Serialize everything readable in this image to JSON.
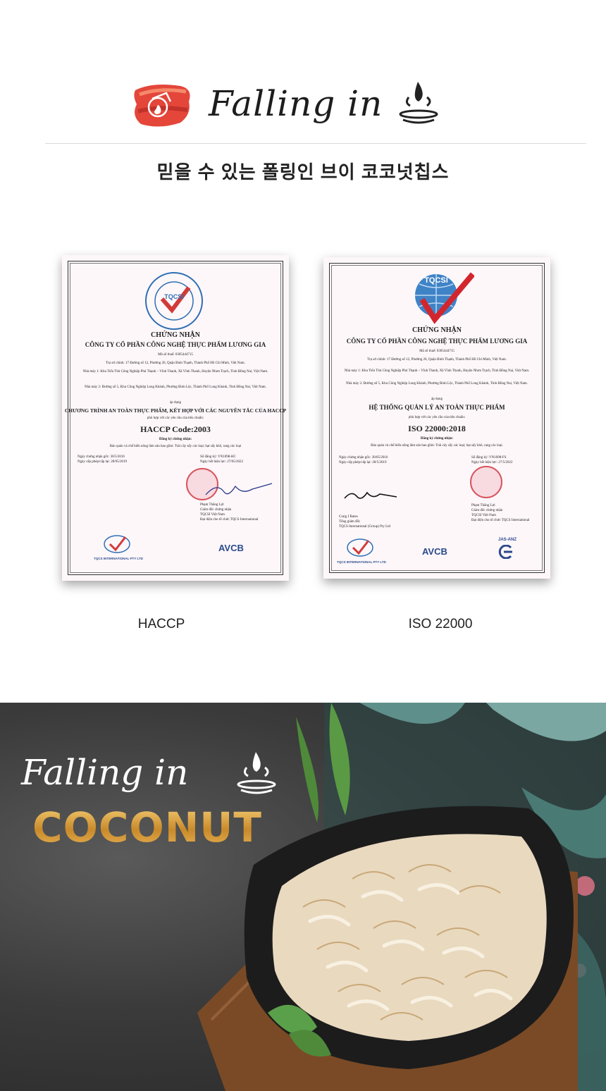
{
  "header": {
    "logo_icon": "brand-emblem-icon",
    "script_title": "Falling in",
    "drop_icon": "water-splash-icon",
    "subtitle": "믿을 수 있는 폴링인 브이 코코넛칩스"
  },
  "certificates": [
    {
      "caption": "HACCP",
      "logo_ring_text": "Food Safety Program",
      "logo_ring_bottom": "HACCP Certified",
      "logo_center": "TQCSI",
      "heading": "CHỨNG NHẬN",
      "company": "CÔNG TY CỔ PHẦN CÔNG NGHỆ THỰC PHẨM LƯƠNG GIA",
      "tax_code": "Mã số thuế: 0305444715",
      "address": "Trụ sở chính: 17 Đường số 12, Phường 26, Quận Bình Thạnh, Thành Phố Hồ Chí Minh, Việt Nam.",
      "factory1": "Nhà máy 1: Khu Tiểu Thủ Công Nghiệp Phú Thạnh – Vĩnh Thanh, Xã Vĩnh Thanh, Huyện Nhơn Trạch, Tỉnh Đồng Nai, Việt Nam.",
      "factory2": "Nhà máy 2: Đường số 5, Khu Công Nghiệp Long Khánh, Phường Bình Lộc, Thành Phố Long Khánh, Tỉnh Đồng Nai, Việt Nam.",
      "applies": "áp dụng",
      "standard": "CHƯƠNG TRÌNH AN TOÀN THỰC PHẨM, KẾT HỢP VỚI CÁC NGUYÊN TẮC CỦA HACCP",
      "conform": "phù hợp với các yêu cầu của tiêu chuẩn:",
      "code": "HACCP Code:2003",
      "registered": "Đăng ký chứng nhận:",
      "scope": "Bảo quản và chế biến nông lâm sản bao gồm: Trái cây sấy các loại; hạt sấy khô, rang các loại",
      "date1": "Ngày chứng nhận gốc: 30/5/2016",
      "date2": "Ngày cấp phép/cấp lại: 28/05/2019",
      "cert_no": "Số đăng ký: VN1098-HC",
      "valid": "Ngày hết hiệu lực: 27/05/2022",
      "signer": "Phạm Thắng Lợi",
      "signer_title": "Giám đốc chứng nhận",
      "signer_org": "TQCSI Việt Nam",
      "signer_note": "Đại diện cho tổ chức TQCS International",
      "foot_left": "TQCSI",
      "foot_left_sub": "TQCS INTERNATIONAL PTY LTD",
      "foot_right": "AVCB"
    },
    {
      "caption": "ISO 22000",
      "logo_center": "TQCSI",
      "heading": "CHỨNG NHẬN",
      "company": "CÔNG TY CỔ PHẦN CÔNG NGHỆ THỰC PHẨM LƯƠNG GIA",
      "tax_code": "Mã số thuế: 0305444715",
      "address": "Trụ sở chính: 17 Đường số 12, Phường 26, Quận Bình Thạnh, Thành Phố Hồ Chí Minh, Việt Nam.",
      "factory1": "Nhà máy 1: Khu Tiểu Thủ Công Nghiệp Phú Thạnh – Vĩnh Thanh, Xã Vĩnh Thanh, Huyện Nhơn Trạch, Tỉnh Đồng Nai, Việt Nam.",
      "factory2": "Nhà máy 2: Đường số 5, Khu Công Nghiệp Long Khánh, Phường Bình Lộc, Thành Phố Long Khánh, Tỉnh Đồng Nai, Việt Nam.",
      "applies": "áp dụng",
      "standard": "HỆ THỐNG QUẢN LÝ AN TOÀN THỰC PHẨM",
      "conform": "phù hợp với các yêu cầu của tiêu chuẩn:",
      "code": "ISO 22000:2018",
      "registered": "Đăng ký chứng nhận:",
      "scope": "Bảo quản và chế biến nông lâm sản bao gồm: Trái cây sấy các loại; hạt sấy khô, rang các loại.",
      "date1": "Ngày chứng nhận gốc: 30/05/2016",
      "date2": "Ngày cấp phép/cấp lại: 28/5/2019",
      "cert_no": "Số đăng ký: VN1098-FS",
      "valid": "Ngày hết hiệu lực: 27/5/2022",
      "signer_left": "Craig J Bates",
      "signer_left_title": "Tổng giám đốc",
      "signer_left_org": "TQCS International (Group) Pty Ltd",
      "signer": "Phạm Thắng Lợi",
      "signer_title": "Giám đốc chứng nhận",
      "signer_org": "TQCSI Việt Nam",
      "signer_note": "Đại diện cho tổ chức TQCS International",
      "foot_left": "TQCSI",
      "foot_left_sub": "TQCS INTERNATIONAL PTY LTD",
      "foot_mid": "AVCB",
      "foot_right": "JAS-ANZ"
    }
  ],
  "photo": {
    "script_title": "Falling in",
    "drop_icon": "water-splash-icon",
    "product_title": "COCONUT",
    "description_icon": "coconut-chips-plate-image"
  },
  "colors": {
    "accent_red": "#d94a3a",
    "gold": "#d8a23a",
    "dark_bg": "#2f2f2f"
  }
}
